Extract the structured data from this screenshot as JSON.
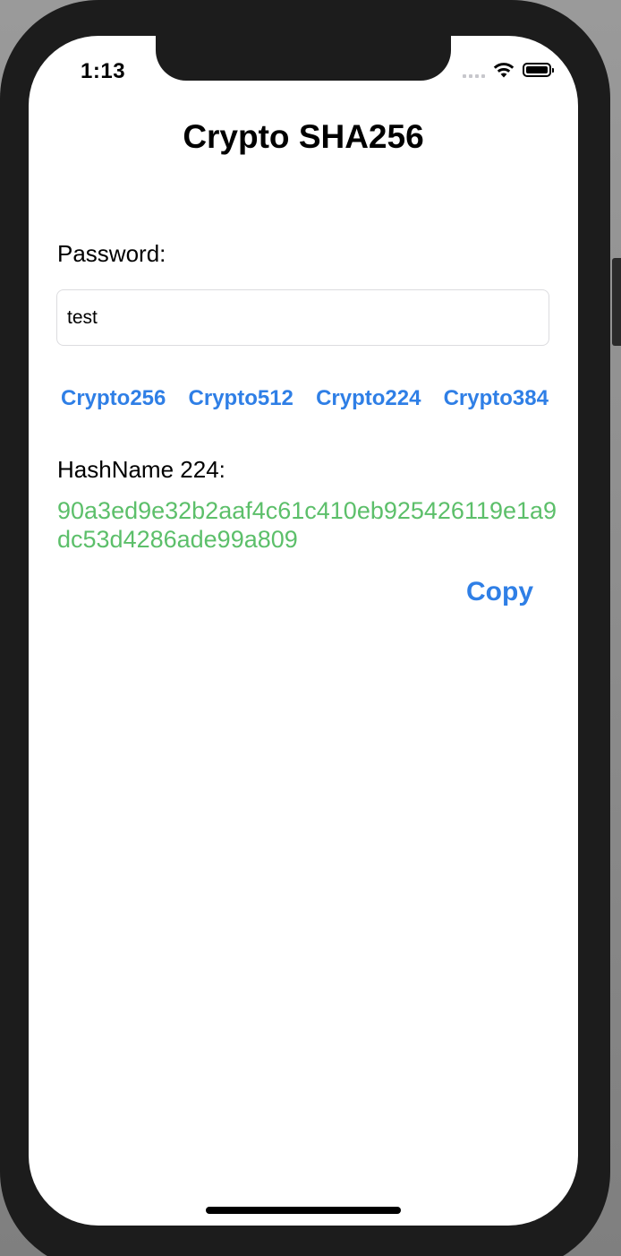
{
  "status_bar": {
    "time": "1:13",
    "icons": [
      "cellular-signal-icon",
      "wifi-icon",
      "battery-icon"
    ]
  },
  "header": {
    "title": "Crypto SHA256"
  },
  "password": {
    "label": "Password:",
    "value": "test",
    "placeholder": ""
  },
  "algorithms": [
    {
      "label": "Crypto256"
    },
    {
      "label": "Crypto512"
    },
    {
      "label": "Crypto224"
    },
    {
      "label": "Crypto384"
    }
  ],
  "result": {
    "label": "HashName 224:",
    "hash": "90a3ed9e32b2aaf4c61c410eb925426119e1a9dc53d4286ade99a809"
  },
  "actions": {
    "copy_label": "Copy"
  },
  "colors": {
    "accent": "#2f7fe6",
    "hash_text": "#5cbf6a",
    "frame": "#1c1c1c"
  }
}
